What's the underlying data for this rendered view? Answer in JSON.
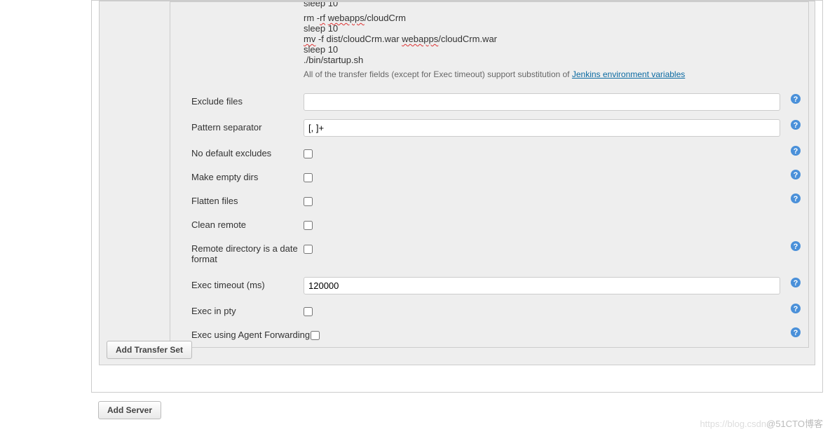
{
  "script": {
    "lines_prefix": "sleep 10\n",
    "line1a": "rm -",
    "line1b": "rf",
    "line1c": " ",
    "line1d": "webapps",
    "line1e": "/cloudCrm",
    "line2": "sleep 10",
    "line3a": "mv",
    "line3b": " -f dist/cloudCrm.war ",
    "line3c": "webapps",
    "line3d": "/cloudCrm.war",
    "line4": "sleep 10",
    "line5": "./bin/startup.sh"
  },
  "description": {
    "text": "All of the transfer fields (except for Exec timeout) support substitution of ",
    "link": "Jenkins environment variables"
  },
  "fields": {
    "exclude_files": {
      "label": "Exclude files",
      "value": ""
    },
    "pattern_separator": {
      "label": "Pattern separator",
      "value": "[, ]+"
    },
    "no_default_excludes": {
      "label": "No default excludes",
      "checked": false
    },
    "make_empty_dirs": {
      "label": "Make empty dirs",
      "checked": false
    },
    "flatten_files": {
      "label": "Flatten files",
      "checked": false
    },
    "clean_remote": {
      "label": "Clean remote",
      "checked": false
    },
    "remote_dir_date": {
      "label": "Remote directory is a date format",
      "checked": false
    },
    "exec_timeout": {
      "label": "Exec timeout (ms)",
      "value": "120000"
    },
    "exec_in_pty": {
      "label": "Exec in pty",
      "checked": false
    },
    "exec_agent_forwarding": {
      "label": "Exec using Agent Forwarding",
      "checked": false
    }
  },
  "buttons": {
    "add_transfer_set": "Add Transfer Set",
    "add_server": "Add Server"
  },
  "watermark": {
    "faint": "https://blog.csdn",
    "text": "@51CTO博客"
  }
}
